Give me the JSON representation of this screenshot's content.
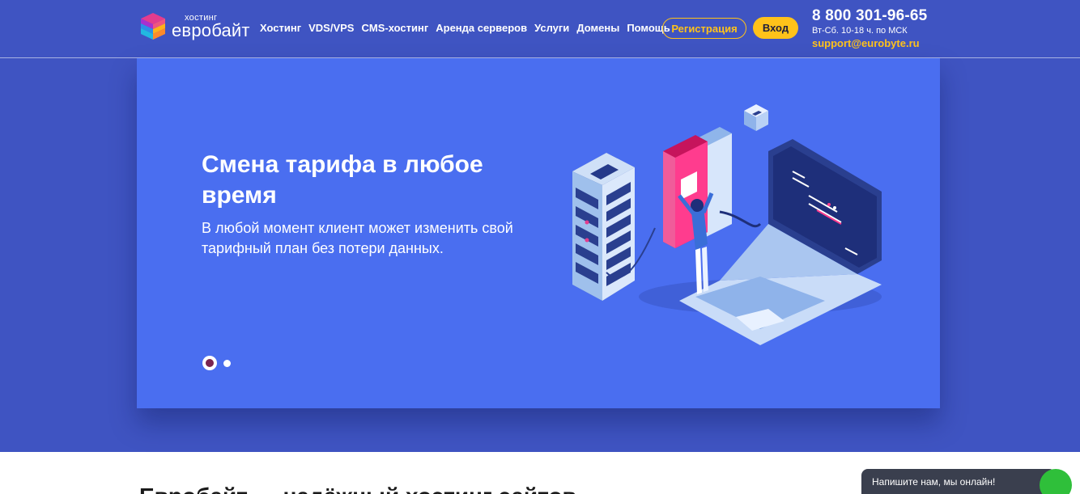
{
  "header": {
    "logo_small": "хостинг",
    "logo_big": "евробайт",
    "nav": [
      "Хостинг",
      "VDS/VPS",
      "CMS-хостинг",
      "Аренда серверов",
      "Услуги",
      "Домены",
      "Помощь"
    ],
    "register_label": "Регистрация",
    "login_label": "Вход",
    "phone": "8 800 301-96-65",
    "hours": "Вт-Сб. 10-18 ч. по МСК",
    "email": "support@eurobyte.ru"
  },
  "slider": {
    "title": "Смена тарифа в любое время",
    "text": "В любой момент клиент может изменить свой тарифный план без потери данных.",
    "slide_count": 2,
    "active_slide": 1
  },
  "chat": {
    "label": "Напишите нам, мы онлайн!"
  },
  "colors": {
    "header_bg": "#3f54c2",
    "slide_bg": "#4a6ef0",
    "accent": "#ffc21a"
  }
}
